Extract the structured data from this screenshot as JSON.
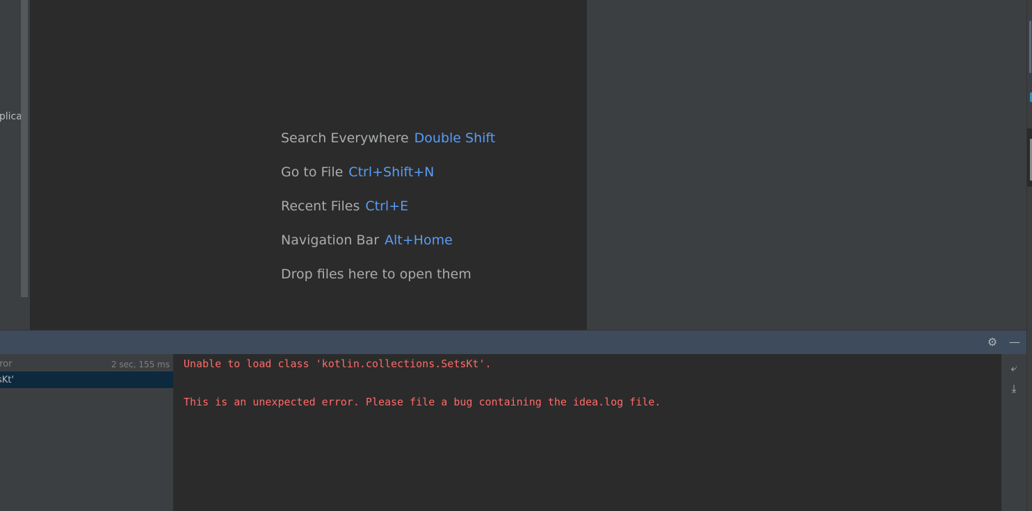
{
  "project_panel": {
    "partial_label": "pplicati"
  },
  "editor": {
    "hints": [
      {
        "label": "Search Everywhere",
        "shortcut": "Double Shift"
      },
      {
        "label": "Go to File",
        "shortcut": "Ctrl+Shift+N"
      },
      {
        "label": "Recent Files",
        "shortcut": "Ctrl+E"
      },
      {
        "label": "Navigation Bar",
        "shortcut": "Alt+Home"
      },
      {
        "label": "Drop files here to open them",
        "shortcut": ""
      }
    ]
  },
  "tool_window": {
    "header_buttons": [
      {
        "icon": "gear-icon",
        "glyph": "⚙"
      },
      {
        "icon": "minimize-icon",
        "glyph": "—"
      }
    ],
    "tree": {
      "rows": [
        {
          "label": "rror",
          "time": "2 sec, 155 ms"
        },
        {
          "label": "sKt'"
        }
      ]
    },
    "console": {
      "lines": [
        "Unable to load class 'kotlin.collections.SetsKt'.",
        "",
        "This is an unexpected error. Please file a bug containing the idea.log file."
      ],
      "error_color": "#ff6b68"
    },
    "side_icons": [
      {
        "icon": "soft-wrap-icon",
        "glyph": "⤶"
      },
      {
        "icon": "scroll-to-end-icon",
        "glyph": "⤓"
      }
    ]
  }
}
